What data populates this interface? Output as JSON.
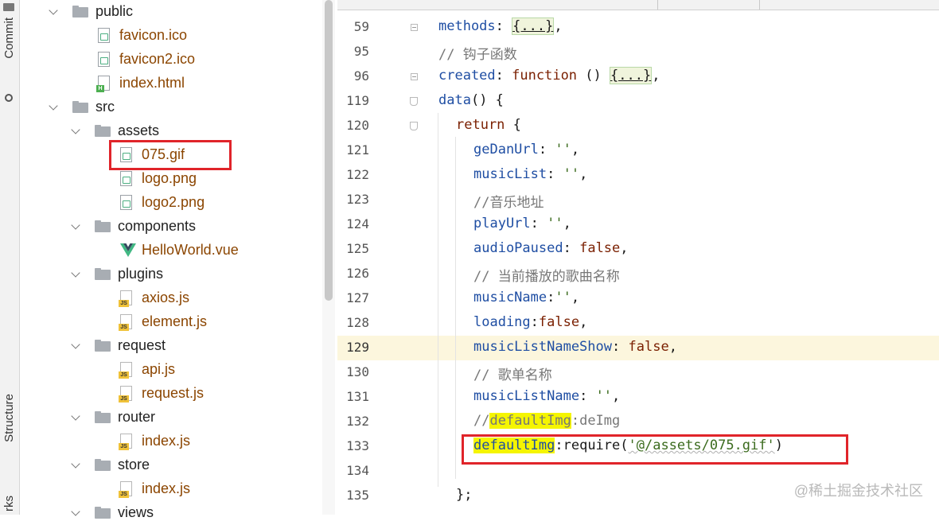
{
  "left_strip": {
    "commit_label": "Commit",
    "structure_label": "Structure",
    "bookmarks_label": "rks"
  },
  "tree": [
    {
      "label": "public",
      "type": "folder"
    },
    {
      "label": "favicon.ico",
      "type": "image"
    },
    {
      "label": "favicon2.ico",
      "type": "image"
    },
    {
      "label": "index.html",
      "type": "html"
    },
    {
      "label": "src",
      "type": "folder"
    },
    {
      "label": "assets",
      "type": "folder"
    },
    {
      "label": "075.gif",
      "type": "image"
    },
    {
      "label": "logo.png",
      "type": "image"
    },
    {
      "label": "logo2.png",
      "type": "image"
    },
    {
      "label": "components",
      "type": "folder"
    },
    {
      "label": "HelloWorld.vue",
      "type": "vue"
    },
    {
      "label": "plugins",
      "type": "folder"
    },
    {
      "label": "axios.js",
      "type": "js"
    },
    {
      "label": "element.js",
      "type": "js"
    },
    {
      "label": "request",
      "type": "folder"
    },
    {
      "label": "api.js",
      "type": "js"
    },
    {
      "label": "request.js",
      "type": "js"
    },
    {
      "label": "router",
      "type": "folder"
    },
    {
      "label": "index.js",
      "type": "js"
    },
    {
      "label": "store",
      "type": "folder"
    },
    {
      "label": "index.js",
      "type": "js"
    },
    {
      "label": "views",
      "type": "folder"
    }
  ],
  "editor": {
    "current_line": "129",
    "line_numbers": [
      "59",
      "95",
      "96",
      "119",
      "120",
      "121",
      "122",
      "123",
      "124",
      "125",
      "126",
      "127",
      "128",
      "129",
      "130",
      "131",
      "132",
      "133",
      "134",
      "135"
    ],
    "code": {
      "l59_key": "methods",
      "colon": ":",
      "fold_text": "{...}",
      "comma": ",",
      "l95_comment": "// 钩子函数",
      "l96_key": "created",
      "l96_fn": "function",
      "l96_parens": " () ",
      "l119_key": "data",
      "l119_rest": "() {",
      "l120_kw": "return",
      "l120_rest": " {",
      "l121_key": "geDanUrl",
      "l121_val": "''",
      "l122_key": "musicList",
      "l122_val": "''",
      "l123_comment": "//音乐地址",
      "l124_key": "playUrl",
      "l124_val": "''",
      "l125_key": "audioPaused",
      "l125_val": "false",
      "l126_comment": "// 当前播放的歌曲名称",
      "l127_key": "musicName",
      "l127_val": "''",
      "l128_key": "loading",
      "l128_val": "false",
      "l129_key": "musicListNameShow",
      "l129_val": "false",
      "l130_comment": "// 歌单名称",
      "l131_key": "musicListName",
      "l131_val": "''",
      "l132_slashes": "//",
      "l132_key": "defaultImg",
      "l132_rest": ":deImg",
      "l133_key": "defaultImg",
      "l133_colon": ":",
      "l133_fn": "require(",
      "l133_str": "'@/assets/075.gif'",
      "l133_close": ")",
      "l135_close": "};"
    }
  },
  "watermark": "@稀土掘金技术社区",
  "colors": {
    "highlight_line": "#fcf6dd",
    "annotation_red": "#e0242a",
    "search_highlight": "#f5f500"
  }
}
